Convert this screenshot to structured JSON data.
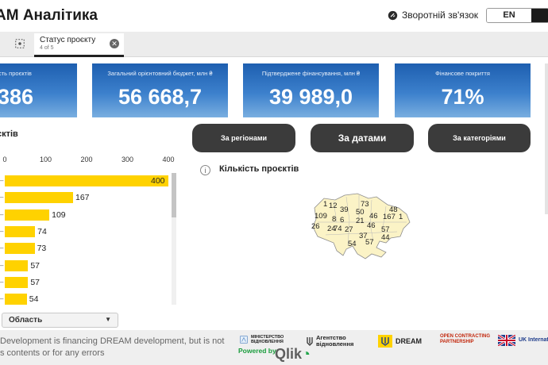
{
  "header": {
    "app_title": "AM Аналітика",
    "feedback_label": "Зворотній зв'язок",
    "lang_label": "EN"
  },
  "tabs": [
    {
      "label": "Статус проєкту",
      "sub": "4 of 5"
    }
  ],
  "kpis": [
    {
      "label": "сть проєктів",
      "value": "386"
    },
    {
      "label": "Загальний орієнтовний бюджет, млн ₴",
      "value": "56 668,7"
    },
    {
      "label": "Підтверджене фінансування, млн ₴",
      "value": "39 989,0"
    },
    {
      "label": "Фінансове покриття",
      "value": "71%"
    }
  ],
  "bar_panel": {
    "title": "єктів",
    "filter_label": "Область"
  },
  "chart_data": {
    "type": "bar",
    "orientation": "horizontal",
    "title": "",
    "x_ticks": [
      0,
      100,
      200,
      300,
      400
    ],
    "xlim": [
      0,
      400
    ],
    "values": [
      400,
      167,
      109,
      74,
      73,
      57,
      57,
      54
    ],
    "value_labels": [
      "400",
      "167",
      "109",
      "74",
      "73",
      "57",
      "57",
      "54"
    ],
    "bar_color": "#ffd200"
  },
  "view_buttons": [
    {
      "label": "За регіонами"
    },
    {
      "label": "За датами"
    },
    {
      "label": "За категоріями"
    }
  ],
  "map_panel": {
    "title": "Кількість проєктів",
    "region_counts": [
      "1",
      "12",
      "39",
      "73",
      "48",
      "50",
      "46",
      "167",
      "109",
      "8",
      "6",
      "21",
      "46",
      "1",
      "24",
      "27",
      "74",
      "26",
      "54",
      "37",
      "44",
      "57",
      "57"
    ]
  },
  "footer": {
    "disclaimer": "Development is financing DREAM development, but is not s contents or for any errors",
    "logos": [
      {
        "name": "Міністерство відновлення",
        "text": "МІНІСТЕРСТВО ВІДНОВЛЕННЯ"
      },
      {
        "name": "Агентство відновлення",
        "text": "Агентство відновлення"
      },
      {
        "name": "DREAM",
        "text": "DREAM"
      },
      {
        "name": "Open Contracting Partnership",
        "text": "OPEN CONTRACTING PARTNERSHIP"
      },
      {
        "name": "UK International Development",
        "text": "UK International Development"
      }
    ],
    "powered_by": "Powered by",
    "qlik": "Qlik"
  },
  "colors": {
    "kpi_gradient_top": "#1e5fb0",
    "kpi_gradient_bottom": "#79aee0",
    "bar_yellow": "#ffd200",
    "pill_dark": "#3b3b3b",
    "qlik_green": "#21a54a"
  }
}
